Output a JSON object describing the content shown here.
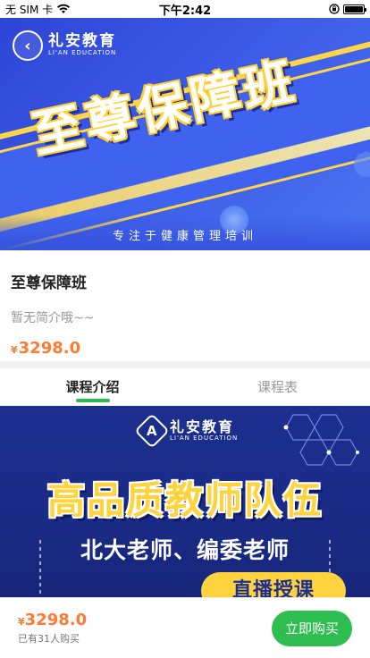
{
  "status_bar": {
    "carrier": "无 SIM 卡",
    "time": "下午2:42"
  },
  "hero": {
    "brand_cn": "礼安教育",
    "brand_en": "LI'AN EDUCATION",
    "title": "至尊保障班",
    "slogan": "专注于健康管理培训"
  },
  "course": {
    "name": "至尊保障班",
    "description": "暂无简介哦~~",
    "currency": "¥",
    "price": "3298.0"
  },
  "tabs": [
    {
      "label": "课程介绍",
      "active": true
    },
    {
      "label": "课程表",
      "active": false
    }
  ],
  "poster": {
    "brand_cn": "礼安教育",
    "brand_en": "LI'AN EDUCATION",
    "headline": "高品质教师队伍",
    "subline": "北大老师、编委老师",
    "pill": "直播授课"
  },
  "footer": {
    "currency": "¥",
    "price": "3298.0",
    "bought": "已有31人购买",
    "buy_label": "立即购买"
  },
  "colors": {
    "accent_green": "#2ebd4f",
    "price_orange": "#ff7a33",
    "hero_blue": "#3c5ae6",
    "poster_navy": "#1d2f8f",
    "gold": "#ffd33d"
  }
}
